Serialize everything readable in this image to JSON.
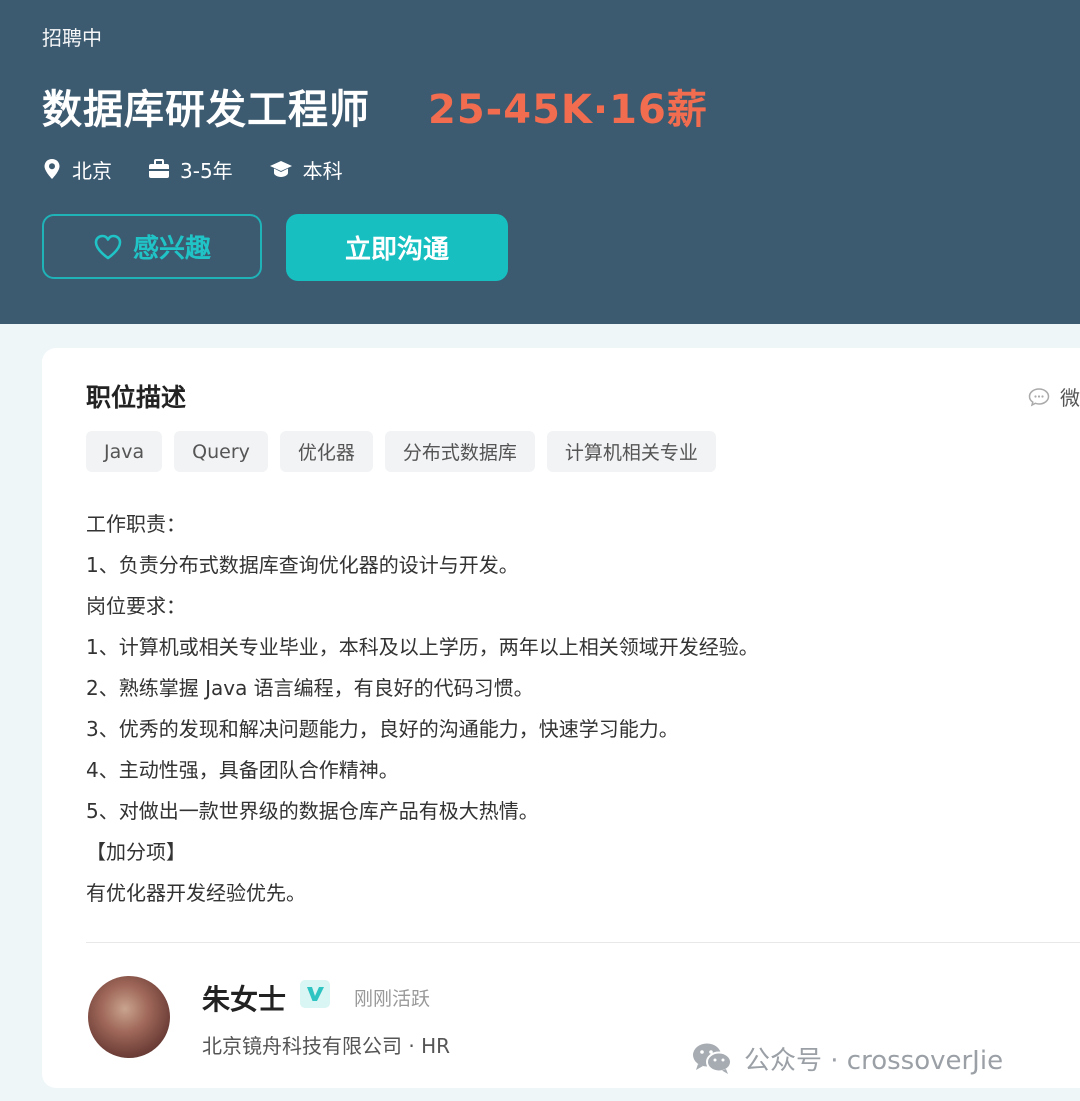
{
  "header": {
    "status": "招聘中",
    "title": "数据库研发工程师",
    "salary": "25-45K·16薪",
    "meta": {
      "location": "北京",
      "experience": "3-5年",
      "education": "本科"
    },
    "interest_label": "感兴趣",
    "chat_label": "立即沟通"
  },
  "job": {
    "section_title": "职位描述",
    "share_label": "微",
    "tags": [
      "Java",
      "Query",
      "优化器",
      "分布式数据库",
      "计算机相关专业"
    ],
    "description_lines": [
      "工作职责：",
      "1、负责分布式数据库查询优化器的设计与开发。",
      "岗位要求：",
      "1、计算机或相关专业毕业，本科及以上学历，两年以上相关领域开发经验。",
      "2、熟练掌握 Java 语言编程，有良好的代码习惯。",
      "3、优秀的发现和解决问题能力，良好的沟通能力，快速学习能力。",
      "4、主动性强，具备团队合作精神。",
      "5、对做出一款世界级的数据仓库产品有极大热情。",
      "【加分项】",
      "有优化器开发经验优先。"
    ]
  },
  "recruiter": {
    "name": "朱女士",
    "verified_badge": "V",
    "active_status": "刚刚活跃",
    "company_line": "北京镜舟科技有限公司 · HR"
  },
  "watermark": "公众号 · crossoverJie",
  "colors": {
    "header_bg": "#3c5a70",
    "salary": "#f26d4f",
    "accent": "#17bfc1"
  },
  "icons": {
    "location": "location-pin-icon",
    "experience": "briefcase-icon",
    "education": "graduation-cap-icon",
    "interest": "heart-icon",
    "share": "wechat-icon"
  }
}
